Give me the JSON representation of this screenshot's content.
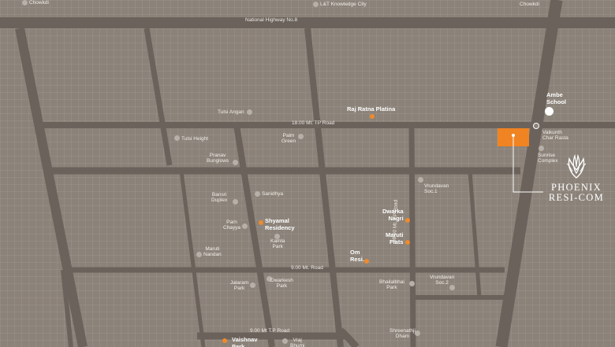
{
  "roads": {
    "national_highway": "National Highway No.8",
    "tp_road_18_east": "18.00 Mt. TP Road",
    "tp_road_18_north": "18.00 Mt. TP Road",
    "tp_road_9": "9.00 Mt. Road",
    "tp_road_9_south": "9.00 Mt T.P Road"
  },
  "landmarks": {
    "chowkdi_left": "Chowkdi",
    "chowkdi_right": "Chowkdi",
    "lt_knowledge_city": "L&T Knowledge City",
    "tulsi_angan": "Tulsi Angan",
    "tulsi_height": "Tulsi Height",
    "palm_green": "Palm\nGreen",
    "pranav_bunglows": "Pranav\nBunglows",
    "bansri_duplex": "Bansri\nDuplex",
    "sanidhya": "Sanidhya",
    "parn_chayya": "Parn\nChayya",
    "kamla_park": "Kamla\nPark",
    "maruti_nandan": "Maruti\nNandan",
    "jalaram_park": "Jalaram\nPark",
    "dwarkesh_park": "Dwarkesh\nPark",
    "vraj_bhumi": "Vraj\nBhumi",
    "vrundavan_soc1": "Vrundavan\nSoc.1",
    "bhailalbhai_park": "Bhailalbhai\nPark",
    "vrundavan_soc2": "Vrundavan\nSoc.2",
    "shreenathji_dham": "Shreenathji\nDham",
    "vaikunth_char_rasta": "Vaikunth\nChar Rasta",
    "sunrise_complex": "Sunrise\nComplex"
  },
  "highlights": {
    "raj_ratna_platina": "Raj Ratna Platina",
    "ambe_school": "Ambe\nSchool",
    "shyamal_residency": "Shyamal\nResidency",
    "dwarka_nagri": "Dwarka\nNagri",
    "maruti_flats": "Maruti\nFlats",
    "om_resi": "Om\nResi.",
    "vaishnav_park": "Vaishnav\nPark"
  },
  "brand": {
    "line1": "PHOENIX",
    "line2": "RESI-COM"
  },
  "colors": {
    "background": "#8b8279",
    "road": "#6b625c",
    "highlight": "#f08a2b",
    "landmark_dot": "#b7b0a8",
    "text": "#ffffff"
  }
}
